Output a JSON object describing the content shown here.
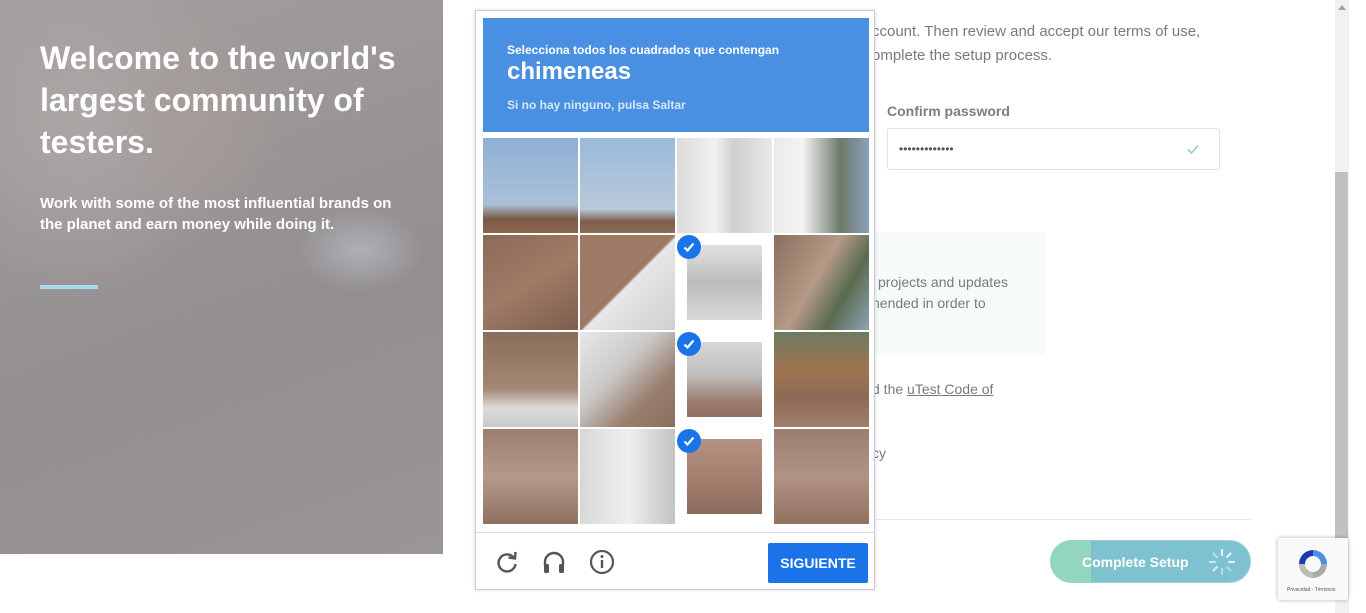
{
  "hero": {
    "title": "Welcome to the world's largest community of testers.",
    "subtitle": "Work with some of the most influential brands on the planet and earn money while doing it."
  },
  "form": {
    "intro_line1": "ccount. Then review and accept our terms of use,",
    "intro_line2": "omplete the setup process.",
    "confirm_label": "Confirm password",
    "confirm_value": "•••••••••••••",
    "notice_line1": "projects and updates",
    "notice_line2": "nended in order to",
    "code_prefix": "d the ",
    "code_link": "uTest Code of",
    "privacy_fragment": "cy",
    "submit_label": "Complete Setup"
  },
  "captcha": {
    "instruction": "Selecciona todos los cuadrados que contengan",
    "target": "chimeneas",
    "hint": "Si no hay ninguno, pulsa Saltar",
    "next_label": "SIGUIENTE",
    "selected_tiles": [
      6,
      10,
      14
    ]
  },
  "badge": {
    "terms": "Privacidad - Términos"
  },
  "colors": {
    "captcha_header": "#4a90e2",
    "captcha_button": "#1a73e8",
    "setup_button": "#7fc2cf"
  }
}
